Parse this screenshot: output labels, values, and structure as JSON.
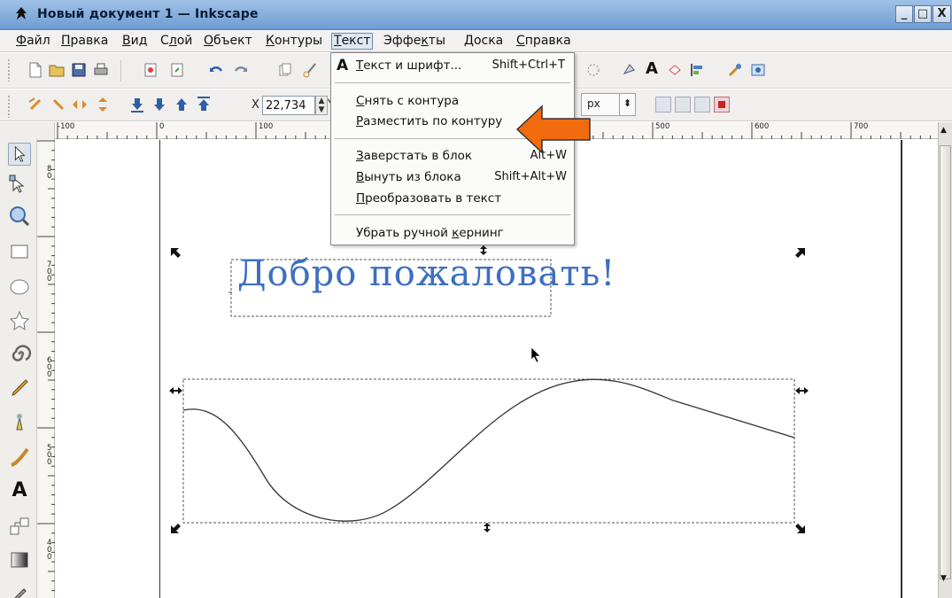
{
  "window": {
    "title": "Новый документ 1 — Inkscape",
    "buttons": [
      "_",
      "□",
      "X"
    ]
  },
  "menubar": {
    "items": [
      {
        "label": "Файл",
        "key": "Ф",
        "rest": "айл"
      },
      {
        "label": "Правка",
        "key": "П",
        "rest": "равка"
      },
      {
        "label": "Вид",
        "key": "В",
        "rest": "ид"
      },
      {
        "label": "Слой",
        "pre": "С",
        "key": "л",
        "rest": "ой"
      },
      {
        "label": "Объект",
        "key": "О",
        "rest": "бъект"
      },
      {
        "label": "Контуры",
        "key": "К",
        "rest": "онтуры"
      },
      {
        "label": "Текст",
        "key": "Т",
        "rest": "екст"
      },
      {
        "label": "Эффекты",
        "pre": "Эффе",
        "key": "к",
        "rest": "ты"
      },
      {
        "label": "Доска",
        "key": "Д",
        "rest": "оска"
      },
      {
        "label": "Справка",
        "key": "С",
        "rest": "правка"
      }
    ]
  },
  "toolbar2": {
    "x_label": "X",
    "x_value": "22,734",
    "y_label": "Y",
    "unit": "px"
  },
  "ruler": {
    "top_labels": [
      "-100",
      "0",
      "100",
      "500",
      "600",
      "700"
    ],
    "left_labels": [
      "8\n0",
      "7\n0\n0",
      "6\n0\n0",
      "5\n0\n0",
      "4\n0\n0"
    ]
  },
  "text_menu": {
    "items": [
      {
        "pre": "",
        "key": "Т",
        "rest": "екст и шрифт...",
        "accel": "Shift+Ctrl+T"
      },
      {
        "pre": "",
        "key": "С",
        "rest": "нять с контура",
        "accel": ""
      },
      {
        "pre": "",
        "key": "Р",
        "rest": "азместить по контуру",
        "accel": ""
      },
      {
        "pre": "",
        "key": "З",
        "rest": "аверстать в блок",
        "accel": "Alt+W"
      },
      {
        "pre": "",
        "key": "В",
        "rest": "ынуть из блока",
        "accel": "Shift+Alt+W"
      },
      {
        "pre": "",
        "key": "П",
        "rest": "реобразовать в текст",
        "accel": ""
      },
      {
        "pre": "Убрать ручной ",
        "key": "к",
        "rest": "ернинг",
        "accel": ""
      }
    ]
  },
  "canvas": {
    "text_object": "Добро пожаловать!",
    "text_color": "#3d6fc0",
    "arrow_color": "#f26b0f"
  }
}
